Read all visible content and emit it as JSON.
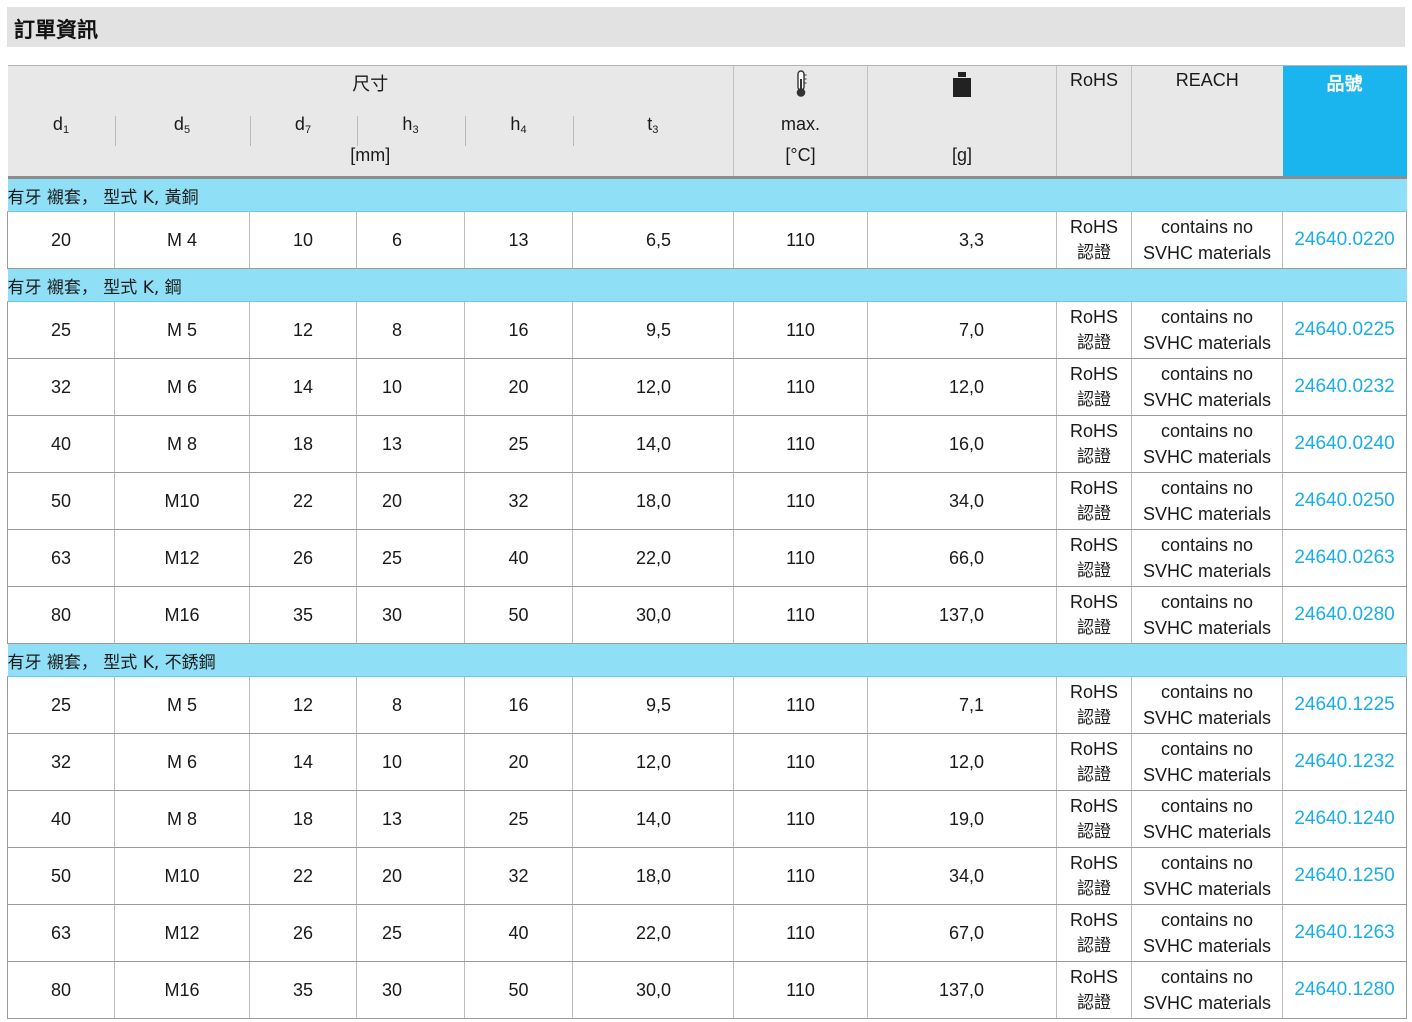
{
  "title": "訂單資訊",
  "header": {
    "dimensions_label": "尺寸",
    "unit_mm": "[mm]",
    "max_label": "max.",
    "unit_c": "[°C]",
    "unit_g": "[g]",
    "rohs": "RoHS",
    "reach": "REACH",
    "part_number": "品號",
    "cols": [
      {
        "base": "d",
        "sub": "1"
      },
      {
        "base": "d",
        "sub": "5"
      },
      {
        "base": "d",
        "sub": "7"
      },
      {
        "base": "h",
        "sub": "3"
      },
      {
        "base": "h",
        "sub": "4"
      },
      {
        "base": "t",
        "sub": "3"
      }
    ],
    "icons": {
      "temperature": "thermometer-icon",
      "weight": "weight-icon"
    }
  },
  "groups": [
    {
      "label": "有牙 襯套， 型式 K, 黃銅",
      "rows": [
        {
          "d1": "20",
          "d5": "M 4",
          "d7": "10",
          "h3": "6",
          "h4": "13",
          "t3": "6,5",
          "max": "110",
          "g": "3,3",
          "rohs1": "RoHS",
          "rohs2": "認證",
          "reach1": "contains no",
          "reach2": "SVHC materials",
          "pn": "24640.0220"
        }
      ]
    },
    {
      "label": "有牙 襯套， 型式 K, 鋼",
      "rows": [
        {
          "d1": "25",
          "d5": "M 5",
          "d7": "12",
          "h3": "8",
          "h4": "16",
          "t3": "9,5",
          "max": "110",
          "g": "7,0",
          "rohs1": "RoHS",
          "rohs2": "認證",
          "reach1": "contains no",
          "reach2": "SVHC materials",
          "pn": "24640.0225"
        },
        {
          "d1": "32",
          "d5": "M 6",
          "d7": "14",
          "h3": "10",
          "h4": "20",
          "t3": "12,0",
          "max": "110",
          "g": "12,0",
          "rohs1": "RoHS",
          "rohs2": "認證",
          "reach1": "contains no",
          "reach2": "SVHC materials",
          "pn": "24640.0232"
        },
        {
          "d1": "40",
          "d5": "M 8",
          "d7": "18",
          "h3": "13",
          "h4": "25",
          "t3": "14,0",
          "max": "110",
          "g": "16,0",
          "rohs1": "RoHS",
          "rohs2": "認證",
          "reach1": "contains no",
          "reach2": "SVHC materials",
          "pn": "24640.0240"
        },
        {
          "d1": "50",
          "d5": "M10",
          "d7": "22",
          "h3": "20",
          "h4": "32",
          "t3": "18,0",
          "max": "110",
          "g": "34,0",
          "rohs1": "RoHS",
          "rohs2": "認證",
          "reach1": "contains no",
          "reach2": "SVHC materials",
          "pn": "24640.0250"
        },
        {
          "d1": "63",
          "d5": "M12",
          "d7": "26",
          "h3": "25",
          "h4": "40",
          "t3": "22,0",
          "max": "110",
          "g": "66,0",
          "rohs1": "RoHS",
          "rohs2": "認證",
          "reach1": "contains no",
          "reach2": "SVHC materials",
          "pn": "24640.0263"
        },
        {
          "d1": "80",
          "d5": "M16",
          "d7": "35",
          "h3": "30",
          "h4": "50",
          "t3": "30,0",
          "max": "110",
          "g": "137,0",
          "rohs1": "RoHS",
          "rohs2": "認證",
          "reach1": "contains no",
          "reach2": "SVHC materials",
          "pn": "24640.0280"
        }
      ]
    },
    {
      "label": "有牙 襯套， 型式 K, 不銹鋼",
      "rows": [
        {
          "d1": "25",
          "d5": "M 5",
          "d7": "12",
          "h3": "8",
          "h4": "16",
          "t3": "9,5",
          "max": "110",
          "g": "7,1",
          "rohs1": "RoHS",
          "rohs2": "認證",
          "reach1": "contains no",
          "reach2": "SVHC materials",
          "pn": "24640.1225"
        },
        {
          "d1": "32",
          "d5": "M 6",
          "d7": "14",
          "h3": "10",
          "h4": "20",
          "t3": "12,0",
          "max": "110",
          "g": "12,0",
          "rohs1": "RoHS",
          "rohs2": "認證",
          "reach1": "contains no",
          "reach2": "SVHC materials",
          "pn": "24640.1232"
        },
        {
          "d1": "40",
          "d5": "M 8",
          "d7": "18",
          "h3": "13",
          "h4": "25",
          "t3": "14,0",
          "max": "110",
          "g": "19,0",
          "rohs1": "RoHS",
          "rohs2": "認證",
          "reach1": "contains no",
          "reach2": "SVHC materials",
          "pn": "24640.1240"
        },
        {
          "d1": "50",
          "d5": "M10",
          "d7": "22",
          "h3": "20",
          "h4": "32",
          "t3": "18,0",
          "max": "110",
          "g": "34,0",
          "rohs1": "RoHS",
          "rohs2": "認證",
          "reach1": "contains no",
          "reach2": "SVHC materials",
          "pn": "24640.1250"
        },
        {
          "d1": "63",
          "d5": "M12",
          "d7": "26",
          "h3": "25",
          "h4": "40",
          "t3": "22,0",
          "max": "110",
          "g": "67,0",
          "rohs1": "RoHS",
          "rohs2": "認證",
          "reach1": "contains no",
          "reach2": "SVHC materials",
          "pn": "24640.1263"
        },
        {
          "d1": "80",
          "d5": "M16",
          "d7": "35",
          "h3": "30",
          "h4": "50",
          "t3": "30,0",
          "max": "110",
          "g": "137,0",
          "rohs1": "RoHS",
          "rohs2": "認證",
          "reach1": "contains no",
          "reach2": "SVHC materials",
          "pn": "24640.1280"
        }
      ]
    }
  ],
  "colors": {
    "group_bg": "#8fe0f6",
    "part_number_bg": "#1ab5ee",
    "link": "#1aaee6",
    "header_bg": "#e8e8e8"
  }
}
